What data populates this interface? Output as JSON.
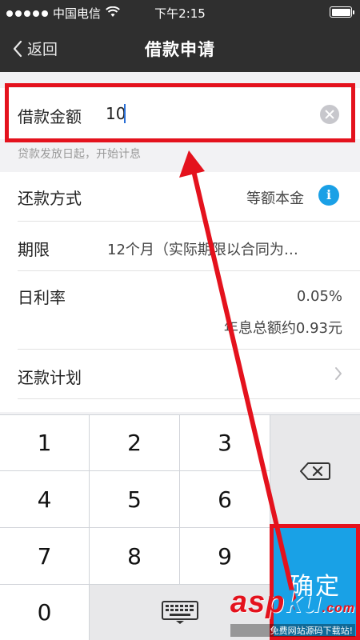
{
  "status_bar": {
    "carrier": "中国电信",
    "time": "下午2:15"
  },
  "nav": {
    "back_label": "返回",
    "title": "借款申请"
  },
  "amount": {
    "label": "借款金额",
    "value": "10"
  },
  "hint": "贷款发放日起，开始计息",
  "rows": {
    "repayment_method": {
      "label": "还款方式",
      "value": "等额本金"
    },
    "term": {
      "label": "期限",
      "value": "12个月（实际期限以合同为…"
    },
    "daily_rate": {
      "label": "日利率",
      "value": "0.05%",
      "sub_value": "年息总额约0.93元"
    },
    "plan": {
      "label": "还款计划"
    }
  },
  "keypad": {
    "keys": [
      "1",
      "2",
      "3",
      "4",
      "5",
      "6",
      "7",
      "8",
      "9",
      "0"
    ],
    "confirm_label": "确定"
  },
  "watermark": {
    "logo_a": "asp",
    "logo_b": "ku",
    "logo_c": ".com",
    "sub": "免费网站源码下载站!"
  },
  "colors": {
    "accent": "#19a1e6",
    "highlight": "#e4121d",
    "nav_bg": "#2f2f2f"
  }
}
